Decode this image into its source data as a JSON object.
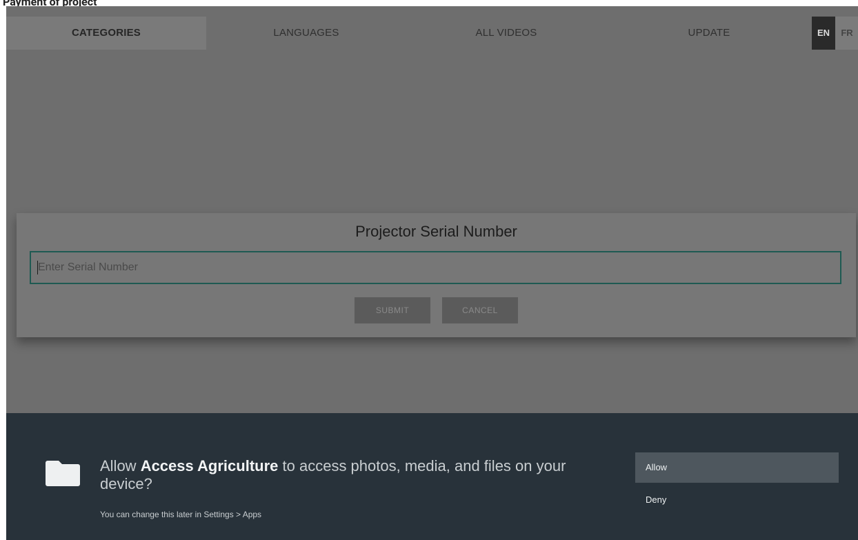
{
  "top_title": "Payment of project",
  "tabs": [
    {
      "label": "CATEGORIES",
      "active": true
    },
    {
      "label": "LANGUAGES",
      "active": false
    },
    {
      "label": "ALL VIDEOS",
      "active": false
    },
    {
      "label": "UPDATE",
      "active": false
    }
  ],
  "language_toggle": {
    "en": "EN",
    "fr": "FR",
    "selected": "EN"
  },
  "dialog": {
    "title": "Projector Serial Number",
    "input_placeholder": "Enter Serial Number",
    "input_value": "",
    "submit_label": "SUBMIT",
    "cancel_label": "CANCEL"
  },
  "permission": {
    "prefix": "Allow ",
    "app_name": "Access Agriculture",
    "suffix": " to access photos, media, and files on your device?",
    "subtext": "You can change this later in Settings > Apps",
    "allow_label": "Allow",
    "deny_label": "Deny",
    "icon": "folder-icon"
  },
  "colors": {
    "overlay": "#6e6e6e",
    "permission_bg": "#28323a",
    "input_border": "#1e5a52",
    "allow_highlight": "#4e575e"
  }
}
